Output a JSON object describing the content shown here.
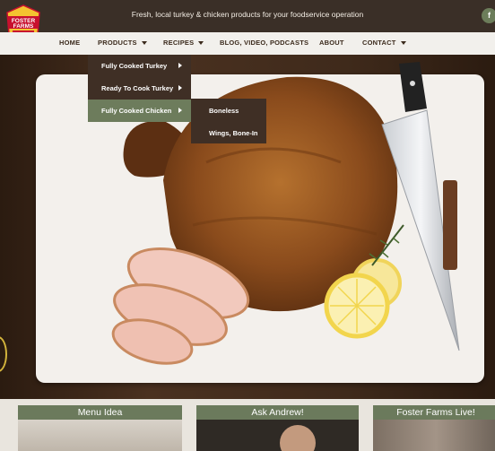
{
  "brand": {
    "logo_text": "FOSTER FARMS",
    "colors": {
      "nav_bg": "#f2f0ec",
      "dark": "#3f2f25",
      "accent_green": "#6d7c5c",
      "logo_red": "#c8102e",
      "logo_yellow": "#f4c430"
    }
  },
  "top_bar": {
    "tagline": "Fresh, local turkey & chicken products for your foodservice operation",
    "social_icon": "f"
  },
  "nav": {
    "items": [
      {
        "label": "HOME",
        "has_caret": false
      },
      {
        "label": "PRODUCTS",
        "has_caret": true
      },
      {
        "label": "RECIPES",
        "has_caret": true
      },
      {
        "label": "BLOG, VIDEO, PODCASTS",
        "has_caret": false
      },
      {
        "label": "ABOUT",
        "has_caret": false
      },
      {
        "label": "CONTACT",
        "has_caret": true
      }
    ]
  },
  "products_menu": {
    "items": [
      {
        "label": "Fully Cooked Turkey",
        "active": false
      },
      {
        "label": "Ready To Cook Turkey",
        "active": false
      },
      {
        "label": "Fully Cooked Chicken",
        "active": true
      }
    ],
    "submenu": [
      {
        "label": "Boneless"
      },
      {
        "label": "Wings, Bone-In"
      }
    ]
  },
  "cards": [
    {
      "title": "Menu Idea"
    },
    {
      "title": "Ask Andrew!"
    },
    {
      "title": "Foster Farms Live!"
    }
  ]
}
